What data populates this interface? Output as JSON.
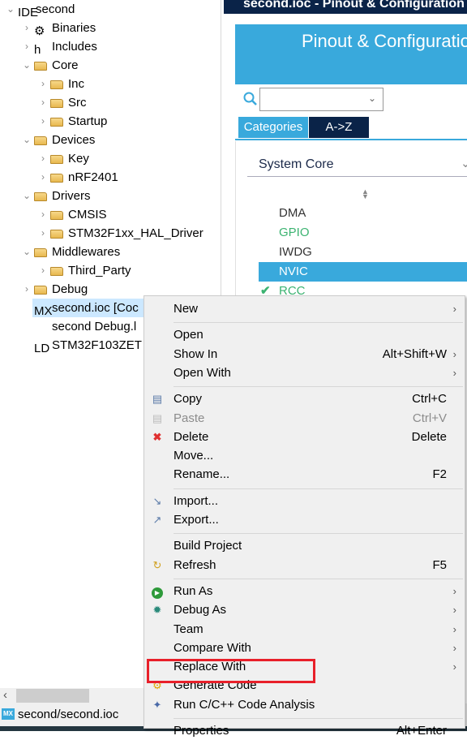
{
  "explorer": {
    "items": [
      {
        "label": "second",
        "level": 0,
        "expanded": true,
        "icon": "ide-project-icon"
      },
      {
        "label": "Binaries",
        "level": 1,
        "expanded": false,
        "icon": "binaries-icon"
      },
      {
        "label": "Includes",
        "level": 1,
        "expanded": false,
        "icon": "includes-icon"
      },
      {
        "label": "Core",
        "level": 1,
        "expanded": true,
        "icon": "source-folder-icon"
      },
      {
        "label": "Inc",
        "level": 2,
        "expanded": false,
        "icon": "folder-icon"
      },
      {
        "label": "Src",
        "level": 2,
        "expanded": false,
        "icon": "folder-icon"
      },
      {
        "label": "Startup",
        "level": 2,
        "expanded": false,
        "icon": "folder-icon"
      },
      {
        "label": "Devices",
        "level": 1,
        "expanded": true,
        "icon": "source-folder-icon"
      },
      {
        "label": "Key",
        "level": 2,
        "expanded": false,
        "icon": "folder-icon"
      },
      {
        "label": "nRF2401",
        "level": 2,
        "expanded": false,
        "icon": "folder-icon"
      },
      {
        "label": "Drivers",
        "level": 1,
        "expanded": true,
        "icon": "source-folder-icon"
      },
      {
        "label": "CMSIS",
        "level": 2,
        "expanded": false,
        "icon": "folder-icon"
      },
      {
        "label": "STM32F1xx_HAL_Driver",
        "level": 2,
        "expanded": false,
        "icon": "folder-icon"
      },
      {
        "label": "Middlewares",
        "level": 1,
        "expanded": true,
        "icon": "source-folder-icon"
      },
      {
        "label": "Third_Party",
        "level": 2,
        "expanded": false,
        "icon": "folder-icon"
      },
      {
        "label": "Debug",
        "level": 1,
        "expanded": false,
        "icon": "folder-icon"
      },
      {
        "label": "second.ioc [Coc",
        "level": 1,
        "icon": "mx-file-icon",
        "selected": true
      },
      {
        "label": "second Debug.l",
        "level": 1,
        "icon": "text-file-icon"
      },
      {
        "label": "STM32F103ZET",
        "level": 1,
        "icon": "linker-file-icon"
      }
    ]
  },
  "status": {
    "path": "second/second.ioc"
  },
  "editor": {
    "title": "second.ioc - Pinout & Configuration",
    "header": "Pinout & Configuration",
    "search_value": "",
    "tabs": [
      "Categories",
      "A->Z"
    ],
    "category": "System Core",
    "items": [
      {
        "label": "DMA",
        "color": "#333333"
      },
      {
        "label": "GPIO",
        "color": "#3cb371"
      },
      {
        "label": "IWDG",
        "color": "#333333"
      },
      {
        "label": "NVIC",
        "color": "#ffffff",
        "selected": true
      },
      {
        "label": "RCC",
        "color": "#3cb371",
        "checked": true
      }
    ]
  },
  "menu": {
    "items": [
      {
        "label": "New",
        "submenu": true
      },
      {
        "sep": true
      },
      {
        "label": "Open"
      },
      {
        "label": "Show In",
        "shortcut": "Alt+Shift+W",
        "submenu": true
      },
      {
        "label": "Open With",
        "submenu": true
      },
      {
        "sep": true
      },
      {
        "label": "Copy",
        "shortcut": "Ctrl+C",
        "icon": "copy-icon"
      },
      {
        "label": "Paste",
        "shortcut": "Ctrl+V",
        "icon": "paste-icon",
        "disabled": true
      },
      {
        "label": "Delete",
        "shortcut": "Delete",
        "icon": "delete-icon"
      },
      {
        "label": "Move..."
      },
      {
        "label": "Rename...",
        "shortcut": "F2"
      },
      {
        "sep": true
      },
      {
        "label": "Import...",
        "icon": "import-icon"
      },
      {
        "label": "Export...",
        "icon": "export-icon"
      },
      {
        "sep": true
      },
      {
        "label": "Build Project"
      },
      {
        "label": "Refresh",
        "shortcut": "F5",
        "icon": "refresh-icon"
      },
      {
        "sep": true
      },
      {
        "label": "Run As",
        "submenu": true,
        "icon": "run-icon"
      },
      {
        "label": "Debug As",
        "submenu": true,
        "icon": "debug-icon"
      },
      {
        "label": "Team",
        "submenu": true
      },
      {
        "label": "Compare With",
        "submenu": true
      },
      {
        "label": "Replace With",
        "submenu": true
      },
      {
        "label": "Generate Code",
        "icon": "generate-code-icon",
        "highlighted": true
      },
      {
        "label": "Run C/C++ Code Analysis",
        "icon": "code-analysis-icon"
      },
      {
        "sep": true
      },
      {
        "label": "Properties",
        "shortcut": "Alt+Enter"
      }
    ]
  },
  "colors": {
    "accent": "#39a9dc",
    "navy": "#0a2348",
    "highlight_box": "#e8202a"
  }
}
